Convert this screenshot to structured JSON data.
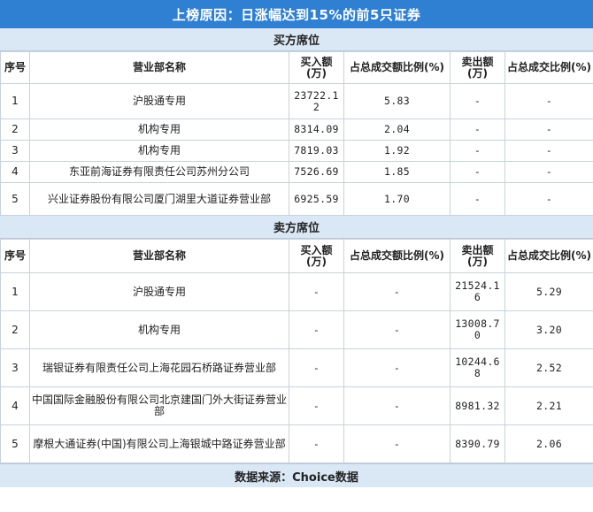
{
  "title": "上榜原因：日涨幅达到15%的前5只证券",
  "buy_section": {
    "label": "买方席位",
    "headers": [
      "序号",
      "营业部名称",
      "买入额(万)",
      "占总成交额比例(%)",
      "卖出额(万)",
      "占总成交比例(%)"
    ],
    "rows": [
      {
        "no": "1",
        "name": "沪股通专用",
        "buy": "23722.12",
        "buy_pct": "5.83",
        "sell": "-",
        "sell_pct": "-"
      },
      {
        "no": "2",
        "name": "机构专用",
        "buy": "8314.09",
        "buy_pct": "2.04",
        "sell": "-",
        "sell_pct": "-"
      },
      {
        "no": "3",
        "name": "机构专用",
        "buy": "7819.03",
        "buy_pct": "1.92",
        "sell": "-",
        "sell_pct": "-"
      },
      {
        "no": "4",
        "name": "东亚前海证券有限责任公司苏州分公司",
        "buy": "7526.69",
        "buy_pct": "1.85",
        "sell": "-",
        "sell_pct": "-"
      },
      {
        "no": "5",
        "name": "兴业证券股份有限公司厦门湖里大道证券营业部",
        "buy": "6925.59",
        "buy_pct": "1.70",
        "sell": "-",
        "sell_pct": "-"
      }
    ]
  },
  "sell_section": {
    "label": "卖方席位",
    "headers": [
      "序号",
      "营业部名称",
      "买入额(万)",
      "占总成交额比例(%)",
      "卖出额(万)",
      "占总成交比例(%)"
    ],
    "rows": [
      {
        "no": "1",
        "name": "沪股通专用",
        "buy": "-",
        "buy_pct": "-",
        "sell": "21524.16",
        "sell_pct": "5.29"
      },
      {
        "no": "2",
        "name": "机构专用",
        "buy": "-",
        "buy_pct": "-",
        "sell": "13008.70",
        "sell_pct": "3.20"
      },
      {
        "no": "3",
        "name": "瑞银证券有限责任公司上海花园石桥路证券营业部",
        "buy": "-",
        "buy_pct": "-",
        "sell": "10244.68",
        "sell_pct": "2.52"
      },
      {
        "no": "4",
        "name": "中国国际金融股份有限公司北京建国门外大街证券营业部",
        "buy": "-",
        "buy_pct": "-",
        "sell": "8981.32",
        "sell_pct": "2.21"
      },
      {
        "no": "5",
        "name": "摩根大通证券(中国)有限公司上海银城中路证券营业部",
        "buy": "-",
        "buy_pct": "-",
        "sell": "8390.79",
        "sell_pct": "2.06"
      }
    ]
  },
  "footer": "数据来源：Choice数据",
  "colors": {
    "title_bg": "#2f80d2",
    "section_bg": "#dae7f4"
  }
}
